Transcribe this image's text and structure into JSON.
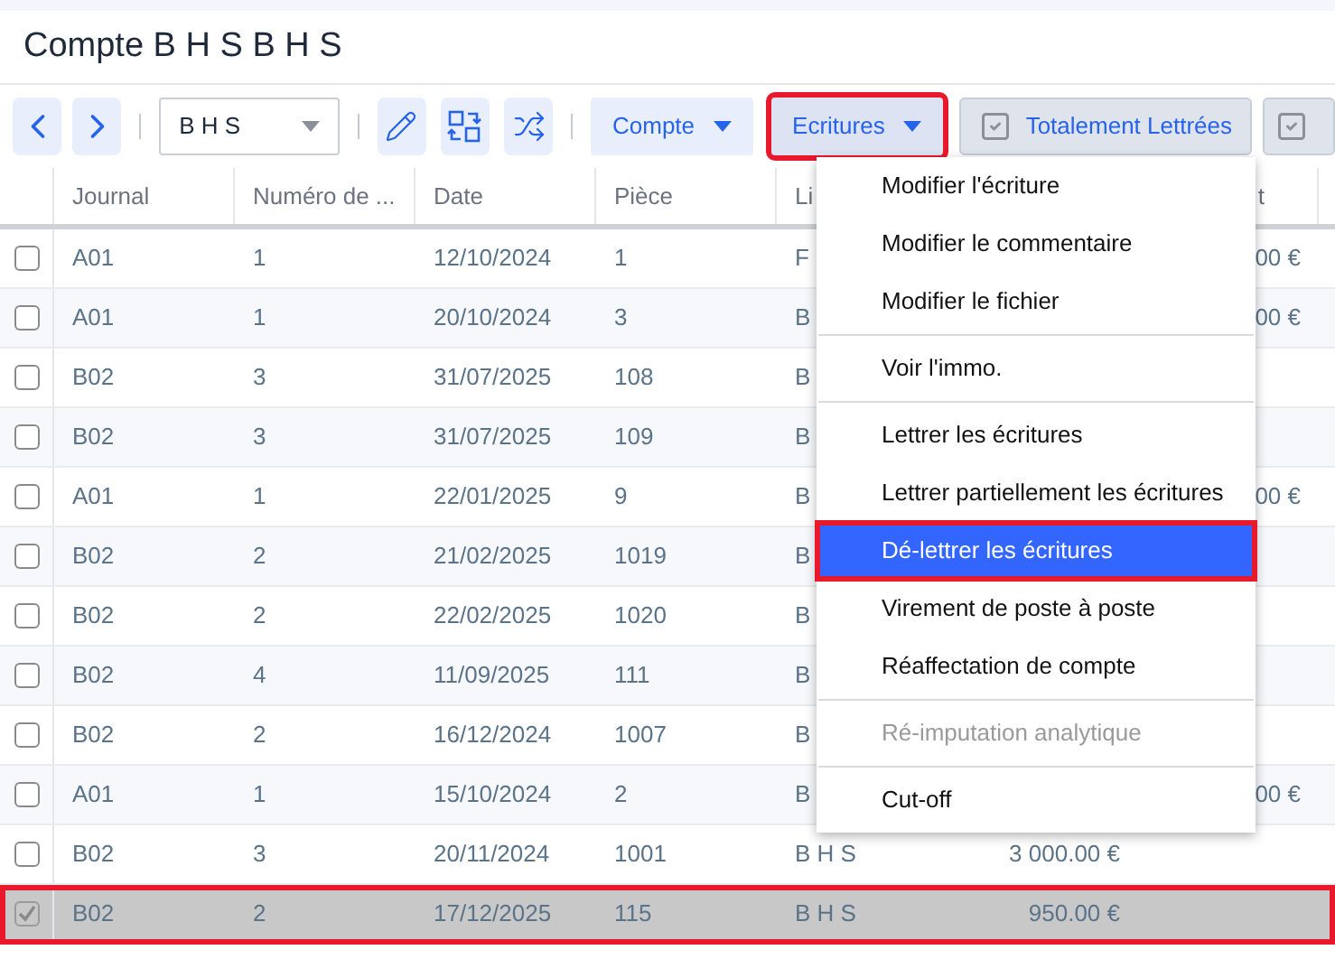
{
  "title": "Compte B H S B H S",
  "toolbar": {
    "account_select": {
      "value": "B H S"
    },
    "menus": [
      {
        "label": "Compte",
        "outlined": false
      },
      {
        "label": "Ecritures",
        "outlined": true
      }
    ],
    "filters": [
      {
        "label": "Totalement Lettrées",
        "checked": true
      }
    ]
  },
  "table": {
    "columns": [
      "Journal",
      "Numéro de ...",
      "Date",
      "Pièce",
      "Li",
      "t"
    ],
    "rows": [
      {
        "checked": false,
        "selected": false,
        "outlined": false,
        "journal": "A01",
        "numero": "1",
        "date": "12/10/2024",
        "piece": "1",
        "column_5": "F",
        "debit": "",
        "column_6": "00 €"
      },
      {
        "checked": false,
        "selected": false,
        "outlined": false,
        "journal": "A01",
        "numero": "1",
        "date": "20/10/2024",
        "piece": "3",
        "column_5": "B",
        "debit": "",
        "column_6": "00 €"
      },
      {
        "checked": false,
        "selected": false,
        "outlined": false,
        "journal": "B02",
        "numero": "3",
        "date": "31/07/2025",
        "piece": "108",
        "column_5": "B",
        "debit": "",
        "column_6": ""
      },
      {
        "checked": false,
        "selected": false,
        "outlined": false,
        "journal": "B02",
        "numero": "3",
        "date": "31/07/2025",
        "piece": "109",
        "column_5": "B",
        "debit": "",
        "column_6": ""
      },
      {
        "checked": false,
        "selected": false,
        "outlined": false,
        "journal": "A01",
        "numero": "1",
        "date": "22/01/2025",
        "piece": "9",
        "column_5": "B",
        "debit": "",
        "column_6": "00 €"
      },
      {
        "checked": false,
        "selected": false,
        "outlined": false,
        "journal": "B02",
        "numero": "2",
        "date": "21/02/2025",
        "piece": "1019",
        "column_5": "B",
        "debit": "",
        "column_6": ""
      },
      {
        "checked": false,
        "selected": false,
        "outlined": false,
        "journal": "B02",
        "numero": "2",
        "date": "22/02/2025",
        "piece": "1020",
        "column_5": "B",
        "debit": "",
        "column_6": ""
      },
      {
        "checked": false,
        "selected": false,
        "outlined": false,
        "journal": "B02",
        "numero": "4",
        "date": "11/09/2025",
        "piece": "111",
        "column_5": "B",
        "debit": "",
        "column_6": ""
      },
      {
        "checked": false,
        "selected": false,
        "outlined": false,
        "journal": "B02",
        "numero": "2",
        "date": "16/12/2024",
        "piece": "1007",
        "column_5": "B",
        "debit": "",
        "column_6": ""
      },
      {
        "checked": false,
        "selected": false,
        "outlined": false,
        "journal": "A01",
        "numero": "1",
        "date": "15/10/2024",
        "piece": "2",
        "column_5": "B",
        "debit": "",
        "column_6": "00 €"
      },
      {
        "checked": false,
        "selected": false,
        "outlined": false,
        "journal": "B02",
        "numero": "3",
        "date": "20/11/2024",
        "piece": "1001",
        "column_5": "B H S",
        "debit": "3 000.00 €",
        "column_6": ""
      },
      {
        "checked": true,
        "selected": true,
        "outlined": true,
        "journal": "B02",
        "numero": "2",
        "date": "17/12/2025",
        "piece": "115",
        "column_5": "B H S",
        "debit": "950.00 €",
        "column_6": ""
      }
    ]
  },
  "dropdown_menu": {
    "items": [
      {
        "label": "Modifier l'écriture",
        "divider_before": false,
        "highlighted": false,
        "disabled": false,
        "outlined": false
      },
      {
        "label": "Modifier le commentaire",
        "divider_before": false,
        "highlighted": false,
        "disabled": false,
        "outlined": false
      },
      {
        "label": "Modifier le fichier",
        "divider_before": false,
        "highlighted": false,
        "disabled": false,
        "outlined": false
      },
      {
        "label": "Voir l'immo.",
        "divider_before": true,
        "highlighted": false,
        "disabled": false,
        "outlined": false
      },
      {
        "label": "Lettrer les écritures",
        "divider_before": true,
        "highlighted": false,
        "disabled": false,
        "outlined": false
      },
      {
        "label": "Lettrer partiellement les écritures",
        "divider_before": false,
        "highlighted": false,
        "disabled": false,
        "outlined": false
      },
      {
        "label": "Dé-lettrer les écritures",
        "divider_before": false,
        "highlighted": true,
        "disabled": false,
        "outlined": true
      },
      {
        "label": "Virement de poste à poste",
        "divider_before": false,
        "highlighted": false,
        "disabled": false,
        "outlined": false
      },
      {
        "label": "Réaffectation de compte",
        "divider_before": false,
        "highlighted": false,
        "disabled": false,
        "outlined": false
      },
      {
        "label": "Ré-imputation analytique",
        "divider_before": true,
        "highlighted": false,
        "disabled": true,
        "outlined": false
      },
      {
        "label": "Cut-off",
        "divider_before": true,
        "highlighted": false,
        "disabled": false,
        "outlined": false
      }
    ]
  }
}
